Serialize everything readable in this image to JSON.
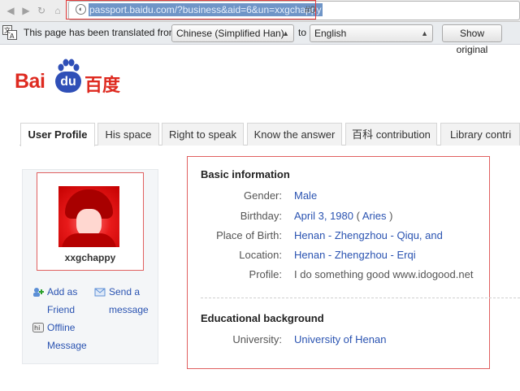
{
  "browser": {
    "url_selected": "passport.baidu.com/?business&aid=6&un=xxgchappy",
    "url_rest": "#0"
  },
  "translate_bar": {
    "prefix": "This page has been translated from",
    "from_lang": "Chinese (Simplified Han)",
    "to_word": "to",
    "to_lang": "English",
    "show_original": "Show original"
  },
  "logo": {
    "latin_left": "Bai",
    "du": "du",
    "chinese": "百度"
  },
  "tabs": [
    {
      "label": "User Profile"
    },
    {
      "label": "His space"
    },
    {
      "label": "Right to speak"
    },
    {
      "label": "Know the answer"
    },
    {
      "label": "百科 contribution"
    },
    {
      "label": "Library contri"
    }
  ],
  "profile": {
    "username": "xxgchappy",
    "actions": {
      "add_friend_1": "Add as",
      "add_friend_2": "Friend",
      "send_msg_1": "Send a",
      "send_msg_2": "message",
      "offline_1": "Offline",
      "offline_2": "Message"
    }
  },
  "basic": {
    "heading": "Basic information",
    "rows": [
      {
        "label": "Gender:",
        "value": "Male"
      },
      {
        "label": "Birthday:",
        "value": "April 3, 1980",
        "extra_open": "(",
        "extra": "Aries",
        "extra_close": ")"
      },
      {
        "label": "Place of Birth:",
        "value": "Henan - Zhengzhou - Qiqu, and"
      },
      {
        "label": "Location:",
        "value": "Henan - Zhengzhou - Erqi"
      },
      {
        "label": "Profile:",
        "value": "I do something good www.idogood.net"
      }
    ]
  },
  "education": {
    "heading": "Educational background",
    "label": "University:",
    "value": "University of Henan"
  },
  "colors": {
    "link": "#2a53b1",
    "brand_red": "#de2a20",
    "brand_blue": "#2f4fb7",
    "highlight_red": "#e06060"
  }
}
